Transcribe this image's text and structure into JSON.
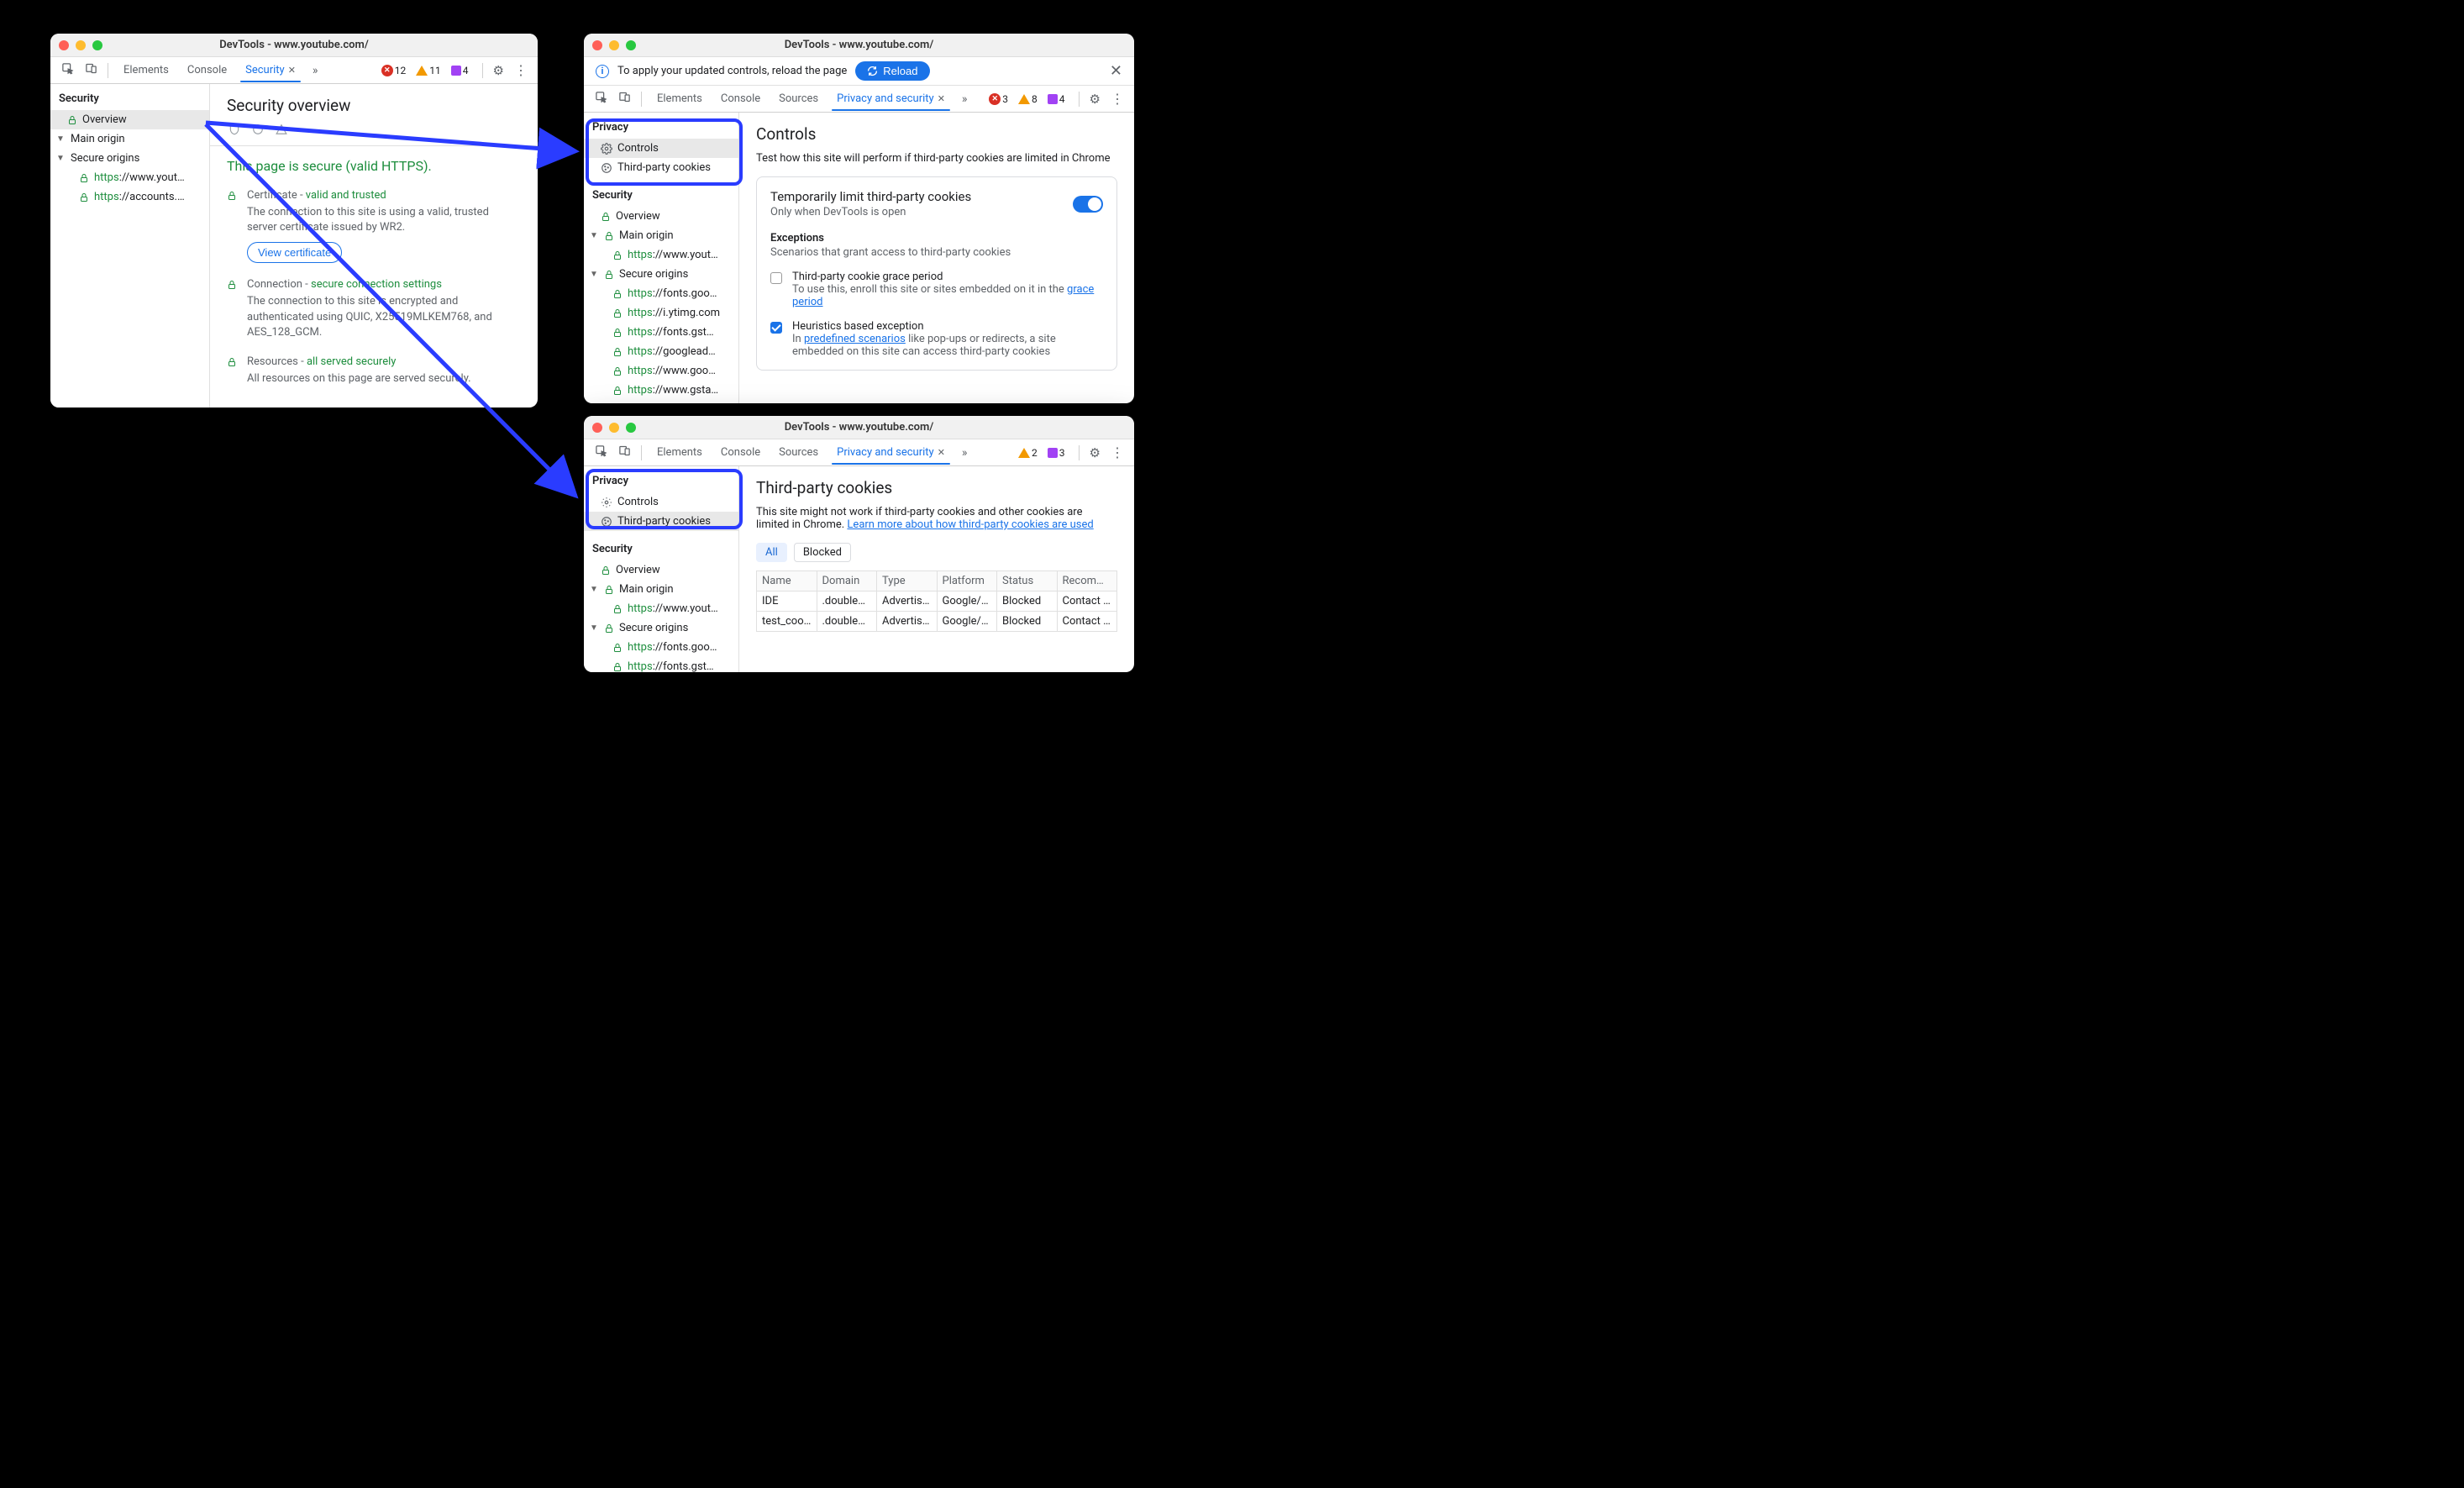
{
  "win1": {
    "title": "DevTools - www.youtube.com/",
    "tabs": [
      "Elements",
      "Console",
      "Security"
    ],
    "active_tab": "Security",
    "counters": {
      "errors": "12",
      "warnings": "11",
      "issues": "4"
    },
    "sidebar": {
      "head": "Security",
      "overview": "Overview",
      "main_origin": "Main origin",
      "secure_origins": "Secure origins",
      "origins": [
        "https://www.yout…",
        "https://accounts.…"
      ]
    },
    "overview": {
      "heading": "Security overview",
      "secure_title": "This page is secure (valid HTTPS).",
      "cert_label": "Certificate - ",
      "cert_status": "valid and trusted",
      "cert_desc": "The connection to this site is using a valid, trusted server certificate issued by WR2.",
      "view_cert_btn": "View certificate",
      "conn_label": "Connection - ",
      "conn_status": "secure connection settings",
      "conn_desc": "The connection to this site is encrypted and authenticated using QUIC, X25519MLKEM768, and AES_128_GCM.",
      "res_label": "Resources - ",
      "res_status": "all served securely",
      "res_desc": "All resources on this page are served securely."
    }
  },
  "win2": {
    "title": "DevTools - www.youtube.com/",
    "info_text": "To apply your updated controls, reload the page",
    "reload_btn": "Reload",
    "tabs": [
      "Elements",
      "Console",
      "Sources",
      "Privacy and security"
    ],
    "active_tab": "Privacy and security",
    "counters": {
      "errors": "3",
      "warnings": "8",
      "issues": "4"
    },
    "sidebar": {
      "privacy_head": "Privacy",
      "controls": "Controls",
      "tpc": "Third-party cookies",
      "security_head": "Security",
      "overview": "Overview",
      "main_origin": "Main origin",
      "main_origin_item": "https://www.yout…",
      "secure_origins": "Secure origins",
      "origins": [
        "https://fonts.goo…",
        "https://i.ytimg.com",
        "https://fonts.gst…",
        "https://googlead…",
        "https://www.goo…",
        "https://www.gsta…"
      ]
    },
    "controls": {
      "heading": "Controls",
      "desc": "Test how this site will perform if third-party cookies are limited in Chrome",
      "card_title": "Temporarily limit third-party cookies",
      "card_sub": "Only when DevTools is open",
      "exceptions_head": "Exceptions",
      "exceptions_desc": "Scenarios that grant access to third-party cookies",
      "exc1_title": "Third-party cookie grace period",
      "exc1_desc_a": "To use this, enroll this site or sites embedded on it in the ",
      "exc1_link": "grace period",
      "exc2_title": "Heuristics based exception",
      "exc2_desc_a": "In ",
      "exc2_link": "predefined scenarios",
      "exc2_desc_b": " like pop-ups or redirects, a site embedded on this site can access third-party cookies"
    }
  },
  "win3": {
    "title": "DevTools - www.youtube.com/",
    "tabs": [
      "Elements",
      "Console",
      "Sources",
      "Privacy and security"
    ],
    "active_tab": "Privacy and security",
    "counters": {
      "warnings": "2",
      "issues": "3"
    },
    "sidebar": {
      "privacy_head": "Privacy",
      "controls": "Controls",
      "tpc": "Third-party cookies",
      "security_head": "Security",
      "overview": "Overview",
      "main_origin": "Main origin",
      "main_origin_item": "https://www.yout…",
      "secure_origins": "Secure origins",
      "origins": [
        "https://fonts.goo…",
        "https://fonts.gst…"
      ]
    },
    "tpc": {
      "heading": "Third-party cookies",
      "desc_a": "This site might not work if third-party cookies and other cookies are limited in Chrome. ",
      "link": "Learn more about how third-party cookies are used",
      "filter_all": "All",
      "filter_blocked": "Blocked",
      "columns": [
        "Name",
        "Domain",
        "Type",
        "Platform",
        "Status",
        "Recomm…"
      ],
      "rows": [
        {
          "name": "IDE",
          "domain": ".double…",
          "type": "Advertisi…",
          "platform": "Google/D…",
          "status": "Blocked",
          "rec": "Contact t…"
        },
        {
          "name": "test_cookie",
          "domain": ".double…",
          "type": "Advertisi…",
          "platform": "Google/D…",
          "status": "Blocked",
          "rec": "Contact t…"
        }
      ]
    }
  }
}
